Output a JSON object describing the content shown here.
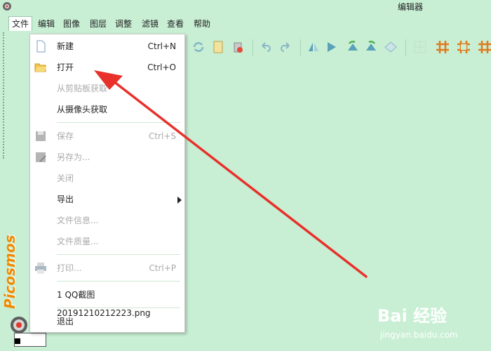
{
  "window": {
    "title": "编辑器"
  },
  "menubar": {
    "items": [
      {
        "label": "文件"
      },
      {
        "label": "编辑"
      },
      {
        "label": "图像"
      },
      {
        "label": "图层"
      },
      {
        "label": "调整"
      },
      {
        "label": "滤镜"
      },
      {
        "label": "查看"
      },
      {
        "label": "帮助"
      }
    ]
  },
  "file_menu": {
    "items": [
      {
        "label": "新建",
        "shortcut": "Ctrl+N",
        "enabled": true,
        "icon": "new-file-icon"
      },
      {
        "label": "打开",
        "shortcut": "Ctrl+O",
        "enabled": true,
        "icon": "open-folder-icon"
      },
      {
        "label": "从剪贴板获取",
        "shortcut": "",
        "enabled": false,
        "icon": ""
      },
      {
        "label": "从摄像头获取",
        "shortcut": "",
        "enabled": true,
        "icon": ""
      },
      {
        "label": "保存",
        "shortcut": "Ctrl+S",
        "enabled": false,
        "icon": "save-icon"
      },
      {
        "label": "另存为...",
        "shortcut": "",
        "enabled": false,
        "icon": "save-as-icon"
      },
      {
        "label": "关闭",
        "shortcut": "",
        "enabled": false,
        "icon": ""
      },
      {
        "label": "导出",
        "shortcut": "",
        "enabled": true,
        "icon": "",
        "submenu": true
      },
      {
        "label": "文件信息...",
        "shortcut": "",
        "enabled": false,
        "icon": ""
      },
      {
        "label": "文件质量...",
        "shortcut": "",
        "enabled": false,
        "icon": ""
      },
      {
        "label": "打印...",
        "shortcut": "Ctrl+P",
        "enabled": false,
        "icon": "print-icon"
      },
      {
        "label": "1 QQ截图20191210212223.png",
        "shortcut": "",
        "enabled": true,
        "icon": ""
      },
      {
        "label": "退出",
        "shortcut": "",
        "enabled": true,
        "icon": ""
      }
    ]
  },
  "sidebar": {
    "brand": "Picosmos"
  },
  "watermark": {
    "text": "Bai 经验",
    "sub": "jingyan.baidu.com"
  },
  "colors": {
    "background": "#c8efd4",
    "accent_orange": "#f08a00",
    "annotation_red": "#e8312b"
  }
}
